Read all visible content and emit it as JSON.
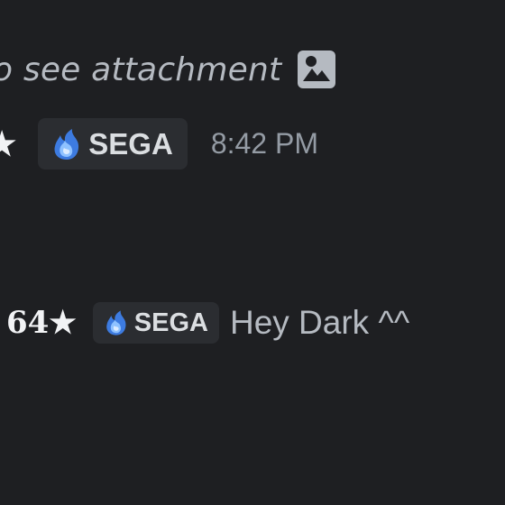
{
  "reply_preview": {
    "text": "o see attachment",
    "icon": "image-icon"
  },
  "header_message": {
    "username_fragment": "★",
    "guild_tag": {
      "icon": "blue-flame-icon",
      "label": "SEGA"
    },
    "timestamp": "8:42 PM"
  },
  "chat_message": {
    "username_fragment": "64★",
    "guild_tag": {
      "icon": "blue-flame-icon",
      "label": "SEGA"
    },
    "content": "Hey Dark ^^"
  },
  "colors": {
    "background": "#1e1f22",
    "tag_background": "#2b2d31",
    "flame": "#5b9bf0"
  }
}
